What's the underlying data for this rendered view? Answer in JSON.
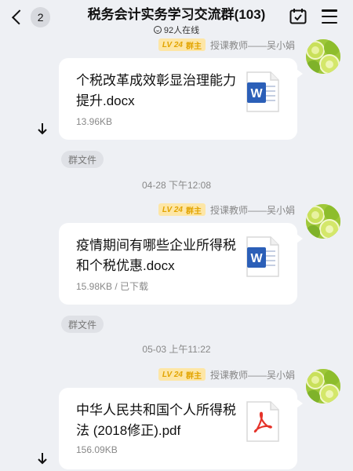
{
  "header": {
    "back_count": "2",
    "title": "税务会计实务学习交流群(103)",
    "online_text": "92人在线",
    "icons": [
      "chevron-left-icon",
      "calendar-check-icon",
      "menu-icon"
    ]
  },
  "messages": [
    {
      "level": "LV 24",
      "role": "群主",
      "sender": "授课教师——吴小娟",
      "file_name": "个税改革成效彰显治理能力提升.docx",
      "file_meta": "13.96KB",
      "file_type": "word",
      "tag": "群文件"
    },
    {
      "timestamp": "04-28 下午12:08",
      "level": "LV 24",
      "role": "群主",
      "sender": "授课教师——吴小娟",
      "file_name": "疫情期间有哪些企业所得税和个税优惠.docx",
      "file_meta": "15.98KB / 已下载",
      "file_type": "word",
      "tag": "群文件"
    },
    {
      "timestamp": "05-03 上午11:22",
      "level": "LV 24",
      "role": "群主",
      "sender": "授课教师——吴小娟",
      "file_name": "中华人民共和国个人所得税法 (2018修正).pdf",
      "file_meta": "156.09KB",
      "file_type": "pdf"
    }
  ],
  "colors": {
    "background": "#eef0f4",
    "level_badge_bg": "#fde6a6",
    "level_badge_text": "#e2a400",
    "word_blue": "#2b5fb8",
    "pdf_red": "#e5332a"
  }
}
